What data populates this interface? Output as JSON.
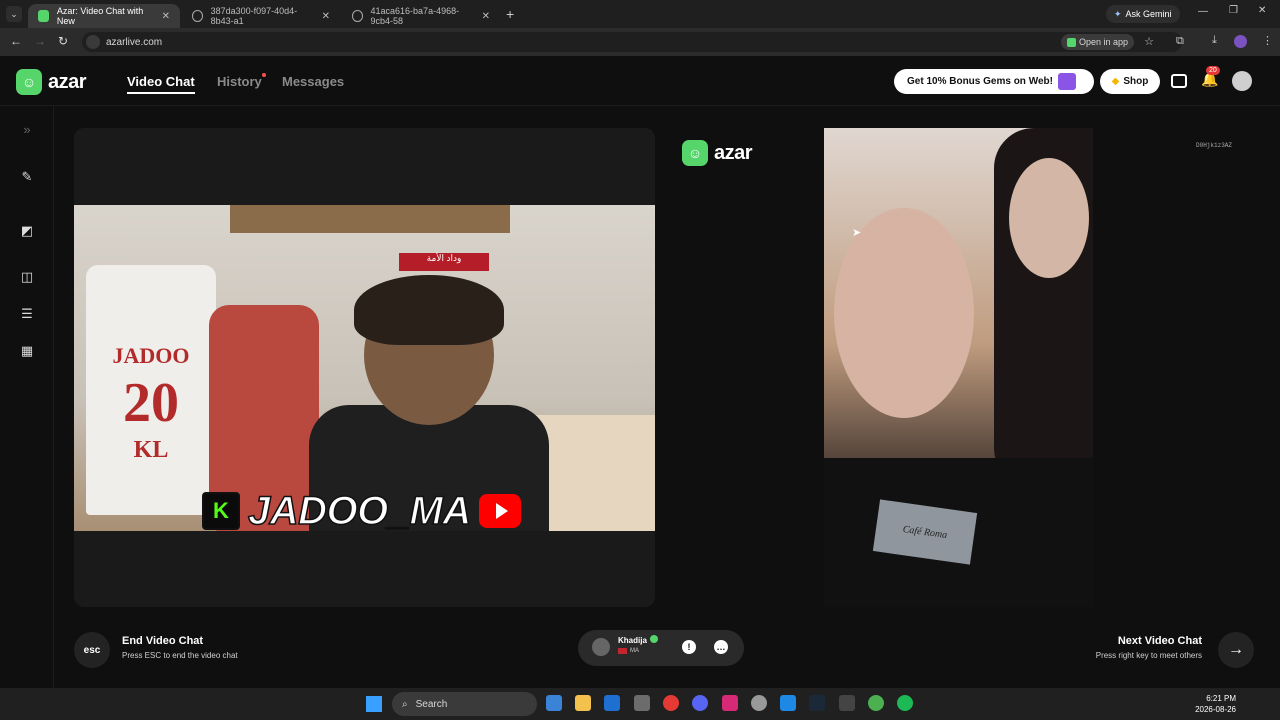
{
  "browser": {
    "tabs": [
      {
        "title": "Azar: Video Chat with New",
        "active": true
      },
      {
        "title": "387da300-f097-40d4-8b43-a1",
        "active": false
      },
      {
        "title": "41aca616-ba7a-4968-9cb4-58",
        "active": false
      }
    ],
    "ask_gemini": "Ask Gemini",
    "url": "azarlive.com",
    "open_in_app": "Open in app"
  },
  "site": {
    "logo_text": "azar",
    "nav": {
      "video_chat": "Video Chat",
      "history": "History",
      "messages": "Messages"
    },
    "bonus_label": "Get 10% Bonus Gems on Web!",
    "shop_label": "Shop",
    "notifications_count": "20"
  },
  "left_video": {
    "jersey_name": "JADOO",
    "jersey_number": "20",
    "jersey_initials": "KL",
    "scarf_text": "وداد الأمة",
    "kick_letter": "K",
    "streamer_handle": "JADOO_MA"
  },
  "right_video": {
    "watermark": "D0Hjk1z3AZ",
    "shirt_label": "Café Roma"
  },
  "controls": {
    "esc_label": "esc",
    "end_title": "End Video Chat",
    "end_sub": "Press ESC to end the video chat",
    "partner_name": "Khadija",
    "partner_country": "MA",
    "next_title": "Next Video Chat",
    "next_sub": "Press right key to meet others"
  },
  "taskbar": {
    "search_label": "Search",
    "time": "6:21 PM",
    "date": "2026-08-26"
  },
  "colors": {
    "azar_green": "#55d56a",
    "bg": "#0f0f0f",
    "youtube_red": "#ff0000",
    "kick_green": "#53fc18"
  }
}
